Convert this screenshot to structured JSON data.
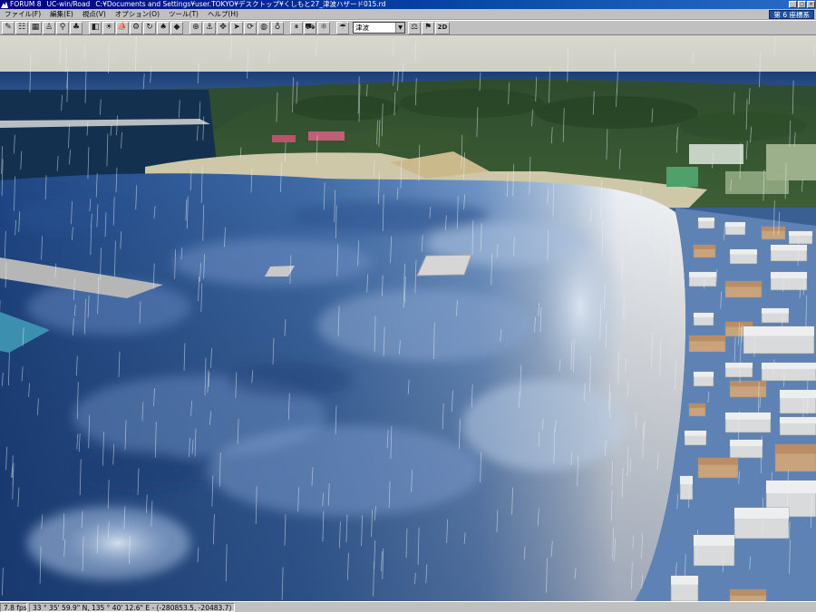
{
  "window": {
    "app": "FORUM 8",
    "product": "UC-win/Road",
    "path": "C:¥Documents and Settings¥user.TOKYO¥デスクトップ¥くしもと27_津波ハザード015.rd",
    "buttons": {
      "minimize": "_",
      "maximize": "□",
      "close": "×"
    }
  },
  "menu": {
    "items": [
      "ファイル(F)",
      "編集(E)",
      "視点(V)",
      "オプション(O)",
      "ツール(T)",
      "ヘルプ(H)"
    ],
    "coord_system": "第 6 座標系"
  },
  "toolbar": {
    "icons": [
      "pencil-icon",
      "road-icon",
      "grid-icon",
      "person-icon",
      "walker-icon",
      "tree-icon",
      "sep",
      "camera-icon",
      "sun-icon",
      "boat-icon",
      "gear-icon",
      "cycle-icon",
      "shrub-icon",
      "car-icon",
      "sep",
      "target-icon",
      "anchor-icon",
      "cross-move-icon",
      "arrow-icon",
      "rotate-icon",
      "globe-icon",
      "pin-icon",
      "sep",
      "pause-icon",
      "car-view-icon",
      "chart-icon"
    ],
    "glyphs": {
      "pencil-icon": "✎",
      "road-icon": "☷",
      "grid-icon": "▦",
      "person-icon": "♙",
      "walker-icon": "⚲",
      "tree-icon": "♣",
      "camera-icon": "◧",
      "sun-icon": "☀",
      "boat-icon": "⛵",
      "gear-icon": "⚙",
      "cycle-icon": "↻",
      "shrub-icon": "♠",
      "car-icon": "◆",
      "target-icon": "⊕",
      "anchor-icon": "⚓",
      "cross-move-icon": "✥",
      "arrow-icon": "➤",
      "rotate-icon": "⟳",
      "globe-icon": "◍",
      "pin-icon": "♁",
      "pause-icon": "⏸",
      "car-view-icon": "⛟",
      "chart-icon": "⚛"
    },
    "weather_select": "津波",
    "view_mode": "2D"
  },
  "status": {
    "fps": "7.8 fps",
    "position": "33 °  35' 59.9\" N, 135 °  40' 12.6\" E  - (-280853.5, -20483.7)"
  },
  "colors": {
    "titlebar": "#000080",
    "water_deep": "#1c3f7a",
    "water_light": "#9fb8d8",
    "foam": "#e8eef4",
    "hill": "#2c4a2a",
    "sky": "#d8d6cc"
  }
}
